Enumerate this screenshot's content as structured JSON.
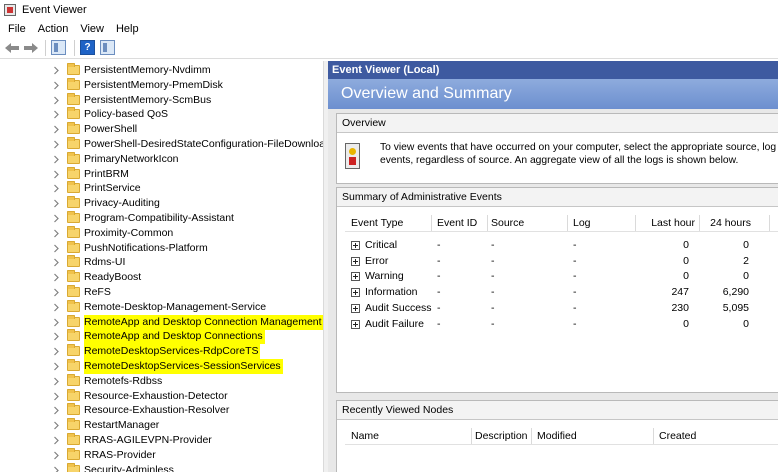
{
  "window": {
    "title": "Event Viewer"
  },
  "menu": [
    "File",
    "Action",
    "View",
    "Help"
  ],
  "toolbar": {
    "back_icon": "arrow-left-icon",
    "forward_icon": "arrow-right-icon",
    "help_glyph": "?"
  },
  "tree": {
    "items": [
      {
        "label": "PersistentMemory-Nvdimm",
        "highlighted": false
      },
      {
        "label": "PersistentMemory-PmemDisk",
        "highlighted": false
      },
      {
        "label": "PersistentMemory-ScmBus",
        "highlighted": false
      },
      {
        "label": "Policy-based QoS",
        "highlighted": false
      },
      {
        "label": "PowerShell",
        "highlighted": false
      },
      {
        "label": "PowerShell-DesiredStateConfiguration-FileDownloa",
        "highlighted": false
      },
      {
        "label": "PrimaryNetworkIcon",
        "highlighted": false
      },
      {
        "label": "PrintBRM",
        "highlighted": false
      },
      {
        "label": "PrintService",
        "highlighted": false
      },
      {
        "label": "Privacy-Auditing",
        "highlighted": false
      },
      {
        "label": "Program-Compatibility-Assistant",
        "highlighted": false
      },
      {
        "label": "Proximity-Common",
        "highlighted": false
      },
      {
        "label": "PushNotifications-Platform",
        "highlighted": false
      },
      {
        "label": "Rdms-UI",
        "highlighted": false
      },
      {
        "label": "ReadyBoost",
        "highlighted": false
      },
      {
        "label": "ReFS",
        "highlighted": false
      },
      {
        "label": "Remote-Desktop-Management-Service",
        "highlighted": false
      },
      {
        "label": "RemoteApp and Desktop Connection Management",
        "highlighted": true
      },
      {
        "label": "RemoteApp and Desktop Connections",
        "highlighted": true
      },
      {
        "label": "RemoteDesktopServices-RdpCoreTS",
        "highlighted": true
      },
      {
        "label": "RemoteDesktopServices-SessionServices",
        "highlighted": true
      },
      {
        "label": "Remotefs-Rdbss",
        "highlighted": false
      },
      {
        "label": "Resource-Exhaustion-Detector",
        "highlighted": false
      },
      {
        "label": "Resource-Exhaustion-Resolver",
        "highlighted": false
      },
      {
        "label": "RestartManager",
        "highlighted": false
      },
      {
        "label": "RRAS-AGILEVPN-Provider",
        "highlighted": false
      },
      {
        "label": "RRAS-Provider",
        "highlighted": false
      },
      {
        "label": "Security-Adminless",
        "highlighted": false
      }
    ]
  },
  "right": {
    "scope_header": "Event Viewer (Local)",
    "overview_title": "Overview and Summary",
    "overview_panel": {
      "title": "Overview",
      "line1": "To view events that have occurred on your computer, select the appropriate source, log or cu",
      "line2": "events, regardless of source. An aggregate view of all the logs is shown below."
    },
    "summary_panel": {
      "title": "Summary of Administrative Events",
      "columns": [
        "Event Type",
        "Event ID",
        "Source",
        "Log",
        "Last hour",
        "24 hours"
      ],
      "rows": [
        {
          "type": "Critical",
          "id": "-",
          "source": "-",
          "log": "-",
          "last_hour": "0",
          "day": "0"
        },
        {
          "type": "Error",
          "id": "-",
          "source": "-",
          "log": "-",
          "last_hour": "0",
          "day": "2"
        },
        {
          "type": "Warning",
          "id": "-",
          "source": "-",
          "log": "-",
          "last_hour": "0",
          "day": "0"
        },
        {
          "type": "Information",
          "id": "-",
          "source": "-",
          "log": "-",
          "last_hour": "247",
          "day": "6,290"
        },
        {
          "type": "Audit Success",
          "id": "-",
          "source": "-",
          "log": "-",
          "last_hour": "230",
          "day": "5,095"
        },
        {
          "type": "Audit Failure",
          "id": "-",
          "source": "-",
          "log": "-",
          "last_hour": "0",
          "day": "0"
        }
      ]
    },
    "recent_panel": {
      "title": "Recently Viewed Nodes",
      "columns": [
        "Name",
        "Description",
        "Modified",
        "Created"
      ]
    }
  },
  "colors": {
    "scope_header_bg": "#3e5aa0",
    "overview_band": "#7a9cd5",
    "highlight": "#ffff00",
    "folder": "#f7d46a"
  }
}
